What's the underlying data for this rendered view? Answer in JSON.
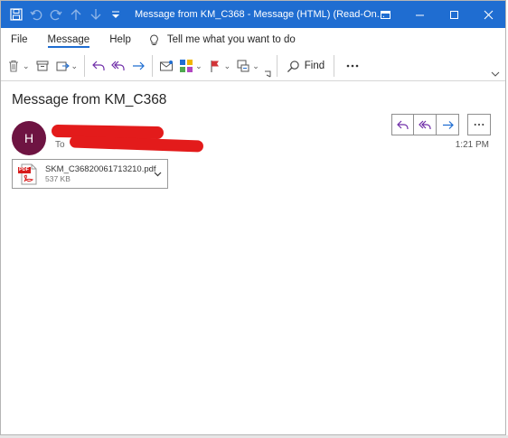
{
  "titlebar": {
    "title": "Message from KM_C368  -  Message (HTML) (Read-On..."
  },
  "menu": {
    "items": [
      {
        "label": "File",
        "active": false
      },
      {
        "label": "Message",
        "active": true
      },
      {
        "label": "Help",
        "active": false
      }
    ],
    "tell_me": "Tell me what you want to do"
  },
  "ribbon": {
    "find_label": "Find"
  },
  "message": {
    "subject": "Message from KM_C368",
    "avatar_initial": "H",
    "to_label": "To",
    "time": "1:21 PM"
  },
  "attachment": {
    "filename": "SKM_C36820061713210.pdf",
    "size": "537 KB",
    "icon_label": "PDF"
  },
  "colors": {
    "titlebar": "#1f6dd1",
    "avatar": "#6e1442",
    "redaction": "#e31b1b",
    "accent_arrow": "#1f6dd1",
    "reply_all_purple": "#6f2da8",
    "flag_red": "#d13438"
  }
}
